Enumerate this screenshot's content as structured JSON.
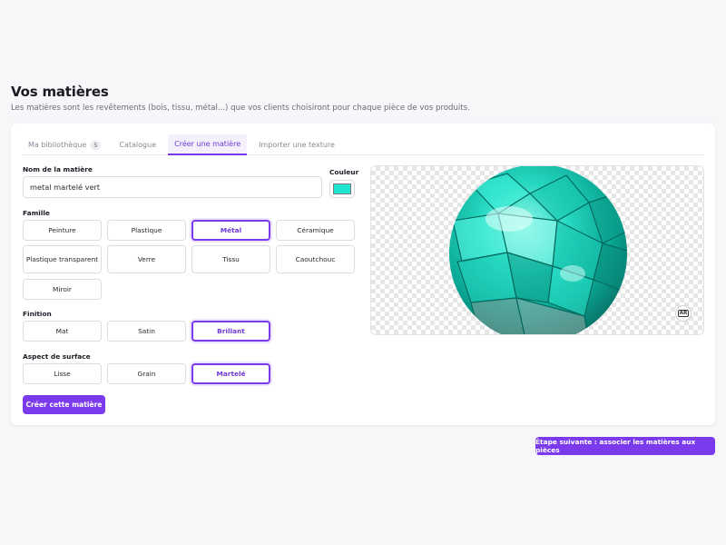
{
  "page": {
    "title": "Vos matières",
    "subtitle": "Les matières sont les revêtements (bois, tissu, métal...) que vos clients choisiront pour chaque pièce de vos produits."
  },
  "tabs": [
    {
      "label": "Ma bibliothèque",
      "count": "5",
      "active": false
    },
    {
      "label": "Catalogue",
      "active": false
    },
    {
      "label": "Créer une matière",
      "active": true
    },
    {
      "label": "Importer une texture",
      "active": false
    }
  ],
  "form": {
    "name_label": "Nom de la matière",
    "name_value": "metal martelé vert",
    "color_label": "Couleur",
    "color_value": "#1ee6cf",
    "family_label": "Famille",
    "family_options": [
      "Peinture",
      "Plastique",
      "Métal",
      "Céramique",
      "Plastique transparent",
      "Verre",
      "Tissu",
      "Caoutchouc",
      "Miroir"
    ],
    "family_selected": "Métal",
    "finish_label": "Finition",
    "finish_options": [
      "Mat",
      "Satin",
      "Brillant"
    ],
    "finish_selected": "Brillant",
    "surface_label": "Aspect de surface",
    "surface_options": [
      "Lisse",
      "Grain",
      "Martelé"
    ],
    "surface_selected": "Martelé",
    "create_button": "Créer cette matière"
  },
  "preview": {
    "ar_badge": "AR",
    "sphere_color": "#1fcfb8"
  },
  "footer": {
    "next_button": "Étape suivante : associer les matières aux pièces"
  },
  "colors": {
    "accent": "#7c3aed",
    "accent_text": "#6f3bd6"
  }
}
